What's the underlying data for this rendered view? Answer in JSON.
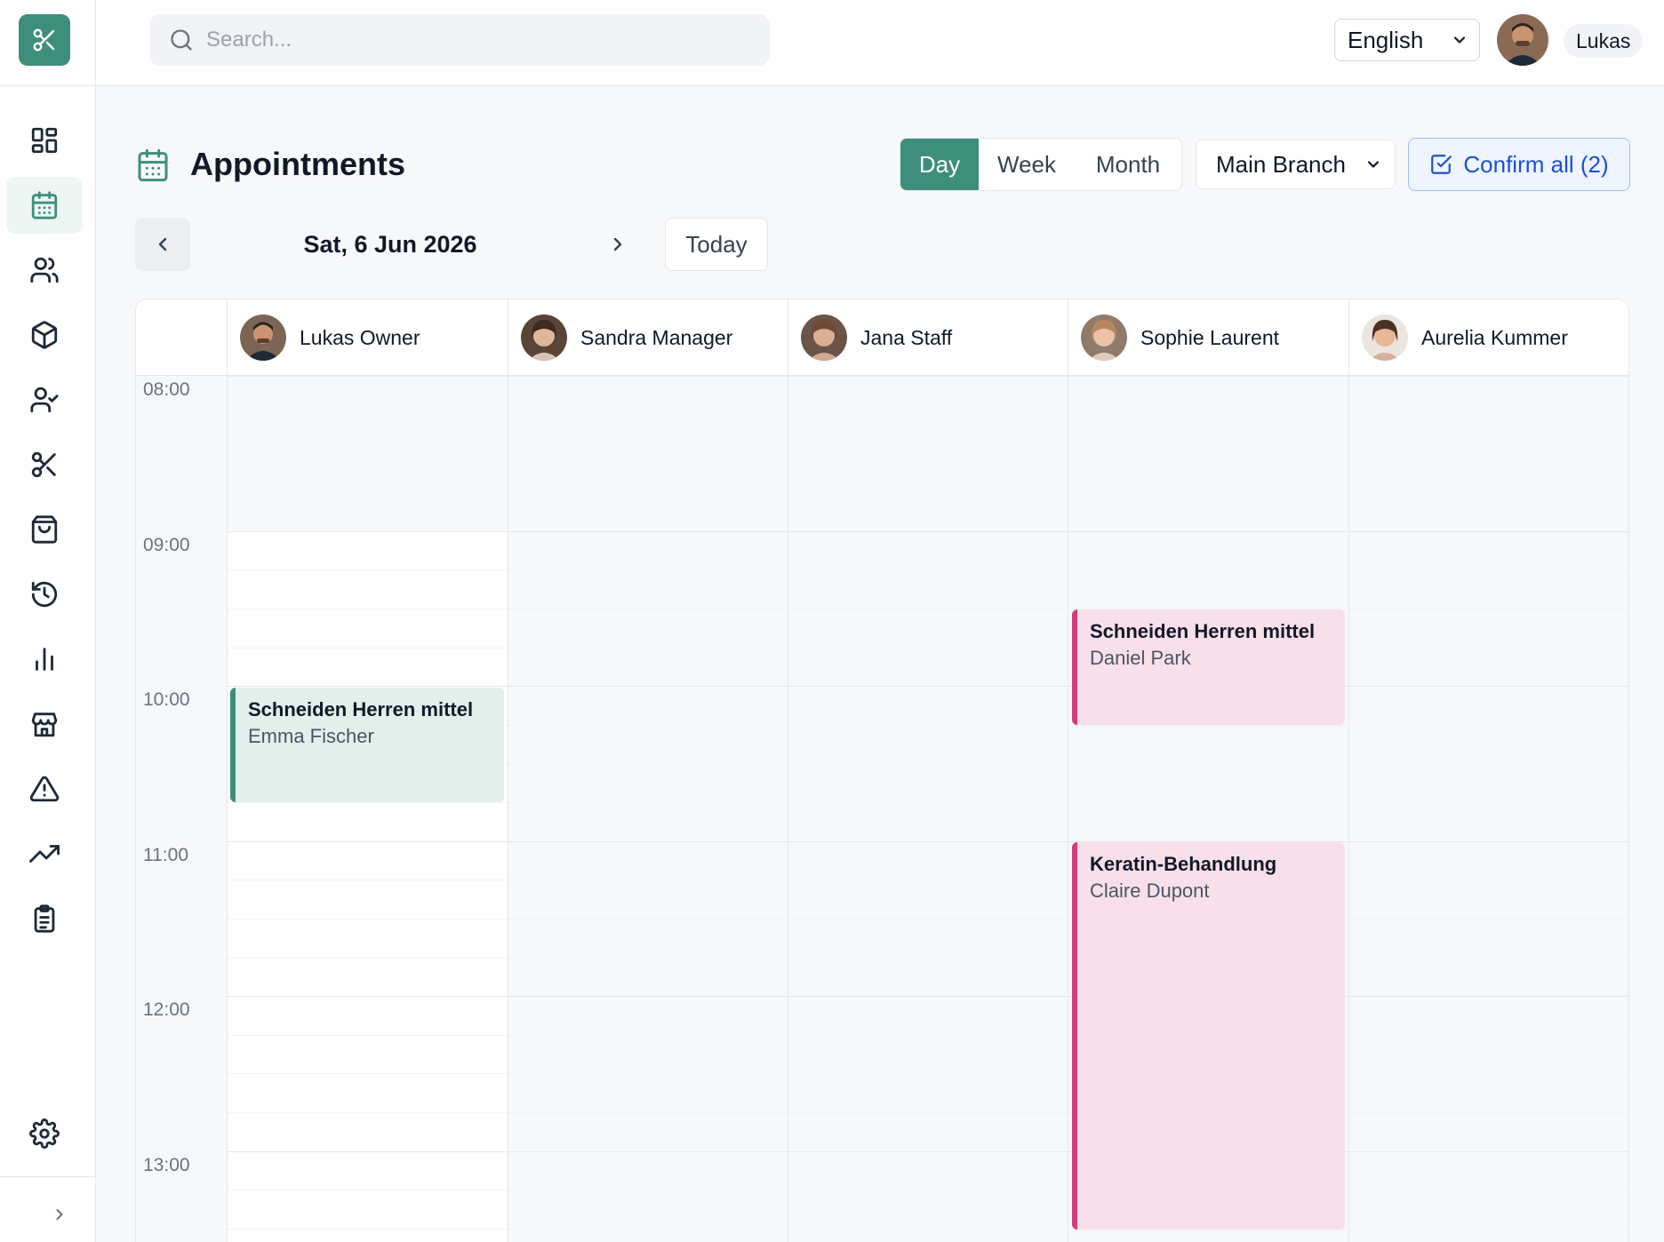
{
  "app": {
    "search_placeholder": "Search...",
    "language": "English",
    "user_name": "Lukas"
  },
  "header": {
    "title": "Appointments",
    "views": [
      "Day",
      "Week",
      "Month"
    ],
    "active_view": "Day",
    "branch": "Main Branch",
    "confirm_label": "Confirm all (2)"
  },
  "date_nav": {
    "date": "Sat, 6 Jun 2026",
    "today_label": "Today"
  },
  "staff": [
    {
      "name": "Lukas Owner"
    },
    {
      "name": "Sandra Manager"
    },
    {
      "name": "Jana Staff"
    },
    {
      "name": "Sophie Laurent"
    },
    {
      "name": "Aurelia Kummer"
    }
  ],
  "time_labels": [
    "08:00",
    "09:00",
    "10:00",
    "11:00",
    "12:00",
    "13:00"
  ],
  "appointments": [
    {
      "staff_index": 0,
      "service": "Schneiden Herren mittel",
      "client": "Emma Fischer",
      "start": "10:00",
      "end": "10:45",
      "color": "#3d8f7c"
    },
    {
      "staff_index": 3,
      "service": "Schneiden Herren mittel",
      "client": "Daniel Park",
      "start": "09:30",
      "end": "10:15",
      "color": "#d13b7a"
    },
    {
      "staff_index": 3,
      "service": "Keratin-Behandlung",
      "client": "Claire Dupont",
      "start": "11:00",
      "end": "13:30",
      "color": "#d13b7a"
    }
  ],
  "colors": {
    "brand": "#3d8f7c",
    "pending": "#d13b7a",
    "confirm_blue": "#1d4ed8"
  },
  "icons": {
    "sidebar": [
      "dashboard-icon",
      "calendar-icon",
      "users-icon",
      "package-icon",
      "user-check-icon",
      "scissors-icon",
      "shopping-bag-icon",
      "history-icon",
      "bar-chart-icon",
      "store-icon",
      "alert-triangle-icon",
      "trending-up-icon",
      "clipboard-icon",
      "settings-icon"
    ]
  }
}
